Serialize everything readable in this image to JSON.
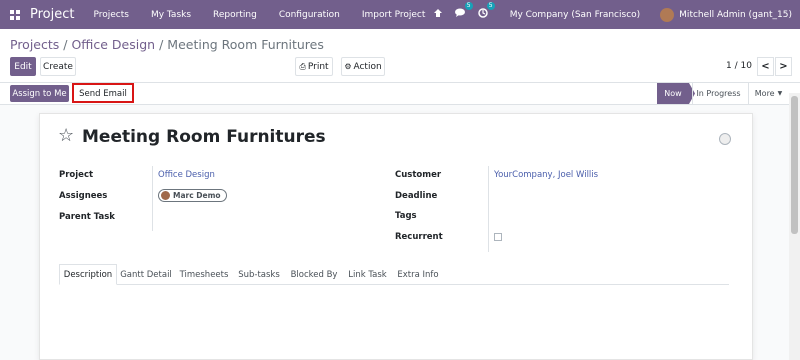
{
  "navbar": {
    "app_name": "Project",
    "menu": [
      "Projects",
      "My Tasks",
      "Reporting",
      "Configuration",
      "Import Project"
    ],
    "messages_count": "5",
    "activities_count": "5",
    "company": "My Company (San Francisco)",
    "user": "Mitchell Admin (gant_15)"
  },
  "breadcrumb": {
    "items": [
      "Projects",
      "Office Design"
    ],
    "current": "Meeting Room Furnitures"
  },
  "toolbar": {
    "edit_label": "Edit",
    "create_label": "Create",
    "print_label": "Print",
    "action_label": "Action",
    "pager": "1 / 10",
    "prev_label": "<",
    "next_label": ">"
  },
  "statusbar": {
    "assign_label": "Assign to Me",
    "send_email_label": "Send Email",
    "stages": [
      "Now",
      "In Progress",
      "More"
    ],
    "active_stage": "Now"
  },
  "task": {
    "title": "Meeting Room Furnitures",
    "fields_left": [
      {
        "label": "Project",
        "value": "Office Design"
      },
      {
        "label": "Assignees",
        "value": "Marc Demo"
      },
      {
        "label": "Parent Task",
        "value": ""
      }
    ],
    "fields_right": [
      {
        "label": "Customer",
        "value": "YourCompany, Joel Willis"
      },
      {
        "label": "Deadline",
        "value": ""
      },
      {
        "label": "Tags",
        "value": ""
      },
      {
        "label": "Recurrent",
        "value": ""
      }
    ],
    "recurrent_checked": false
  },
  "tabs": {
    "items": [
      "Description",
      "Gantt Detail",
      "Timesheets",
      "Sub-tasks",
      "Blocked By",
      "Link Task",
      "Extra Info"
    ],
    "active": "Description"
  },
  "colors": {
    "brand": "#725f8c",
    "link": "#4a5eab",
    "highlight": "#d81515"
  }
}
